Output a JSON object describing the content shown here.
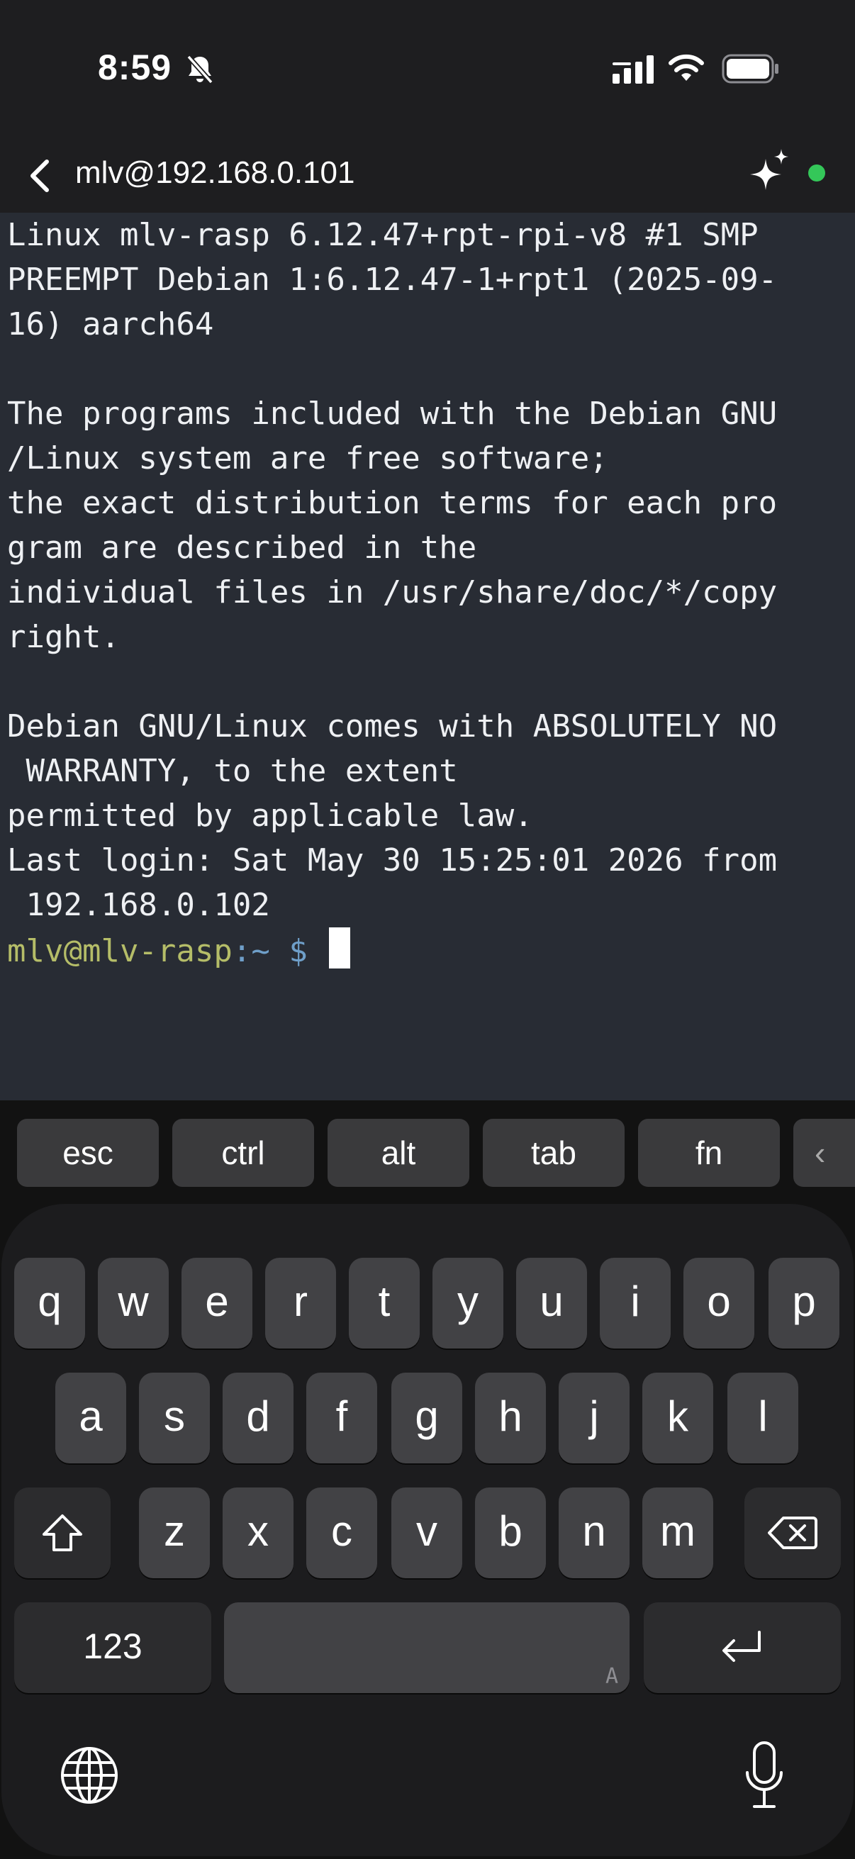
{
  "status_bar": {
    "time": "8:59",
    "icons": [
      "bell-slash-icon",
      "cellular-signal-icon",
      "wifi-icon",
      "battery-icon"
    ]
  },
  "nav": {
    "back_icon": "chevron-left-icon",
    "host": "mlv@192.168.0.101",
    "ai_icon": "sparkles-icon",
    "connection_status_color": "#34c759"
  },
  "terminal": {
    "lines": [
      "Linux mlv-rasp 6.12.47+rpt-rpi-v8 #1 SMP",
      "PREEMPT Debian 1:6.12.47-1+rpt1 (2025-09-",
      "16) aarch64",
      "",
      "The programs included with the Debian GNU",
      "/Linux system are free software;",
      "the exact distribution terms for each pro",
      "gram are described in the",
      "individual files in /usr/share/doc/*/copy",
      "right.",
      "",
      "Debian GNU/Linux comes with ABSOLUTELY NO",
      " WARRANTY, to the extent",
      "permitted by applicable law.",
      "Last login: Sat May 30 15:25:01 2026 from",
      " 192.168.0.102"
    ],
    "prompt_user": "mlv@mlv-rasp",
    "prompt_path": ":~ $",
    "colors": {
      "background": "#282c34",
      "user": "#b5bd68",
      "path": "#6f9fc9"
    }
  },
  "extra_keys": [
    "esc",
    "ctrl",
    "alt",
    "tab",
    "fn"
  ],
  "keyboard": {
    "row1": [
      "q",
      "w",
      "e",
      "r",
      "t",
      "y",
      "u",
      "i",
      "o",
      "p"
    ],
    "row2": [
      "a",
      "s",
      "d",
      "f",
      "g",
      "h",
      "j",
      "k",
      "l"
    ],
    "row3": [
      "z",
      "x",
      "c",
      "v",
      "b",
      "n",
      "m"
    ],
    "numbers_key": "123",
    "space_hint": "A",
    "icons": [
      "shift-icon",
      "backspace-icon",
      "return-icon",
      "globe-icon",
      "microphone-icon"
    ]
  }
}
